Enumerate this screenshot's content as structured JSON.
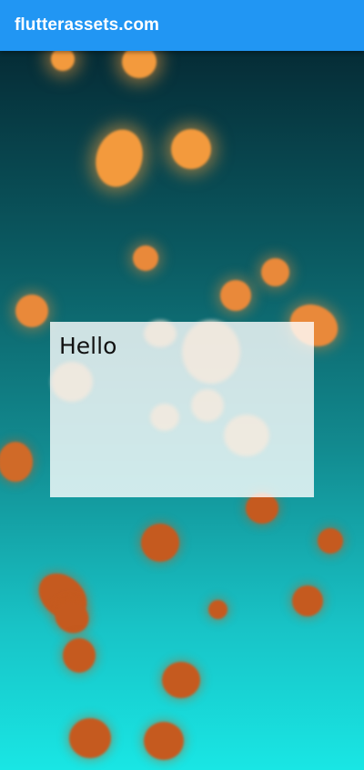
{
  "app_bar": {
    "title": "flutterassets.com",
    "color": "#2196f3"
  },
  "panel": {
    "text": "Hello"
  },
  "colors": {
    "bubble_orange": "#f39a3d",
    "bubble_dark_orange": "#c55a1f",
    "gradient_top": "#052c36",
    "gradient_bottom": "#19e6e4"
  }
}
